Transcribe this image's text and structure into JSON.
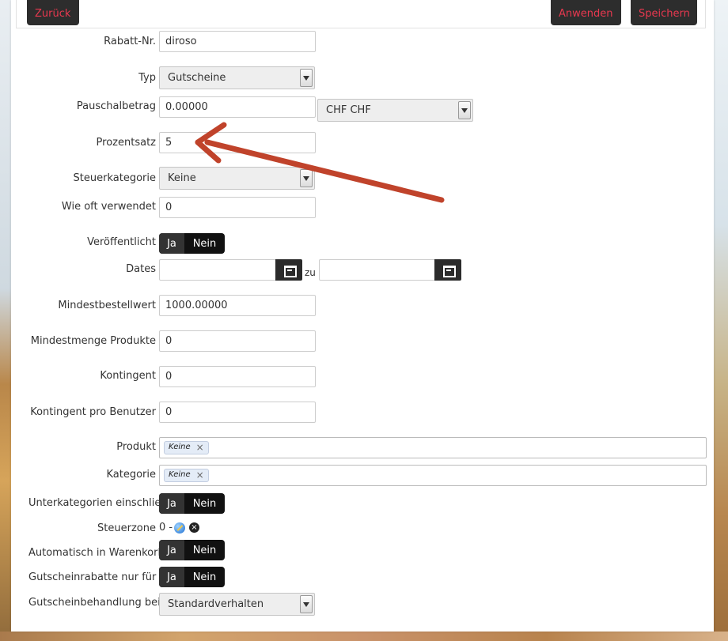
{
  "toolbar": {
    "back_label": "Zurück",
    "apply_label": "Anwenden",
    "save_label": "Speichern"
  },
  "form": {
    "rabatt_nr": {
      "label": "Rabatt-Nr.",
      "value": "diroso"
    },
    "typ": {
      "label": "Typ",
      "value": "Gutscheine"
    },
    "pauschalbetrag": {
      "label": "Pauschalbetrag",
      "value": "0.00000",
      "currency": "CHF CHF"
    },
    "prozentsatz": {
      "label": "Prozentsatz",
      "value": "5"
    },
    "steuerkategorie": {
      "label": "Steuerkategorie",
      "value": "Keine"
    },
    "wie_oft": {
      "label": "Wie oft verwendet",
      "value": "0"
    },
    "veroeffentlicht": {
      "label": "Veröffentlicht",
      "yes": "Ja",
      "no": "Nein",
      "selected": "Ja"
    },
    "dates": {
      "label": "Dates",
      "from": "",
      "to": "",
      "separator": "zu"
    },
    "mindestbestellwert": {
      "label": "Mindestbestellwert",
      "value": "1000.00000"
    },
    "mindestmenge": {
      "label": "Mindestmenge Produkte",
      "value": "0"
    },
    "kontingent": {
      "label": "Kontingent",
      "value": "0"
    },
    "kontingent_user": {
      "label": "Kontingent pro Benutzer",
      "value": "0"
    },
    "produkt": {
      "label": "Produkt",
      "tag": "Keine"
    },
    "kategorie": {
      "label": "Kategorie",
      "tag": "Keine"
    },
    "unterkategorien": {
      "label": "Unterkategorien einschließ",
      "yes": "Ja",
      "no": "Nein"
    },
    "steuerzone": {
      "label": "Steuerzone",
      "value": "0 -"
    },
    "automatisch": {
      "label": "Automatisch in Warenkorb",
      "yes": "Ja",
      "no": "Nein"
    },
    "gutscheinrabatte": {
      "label": "Gutscheinrabatte nur für P",
      "yes": "Ja",
      "no": "Nein"
    },
    "gutscheinbehandlung": {
      "label": "Gutscheinbehandlung bei",
      "value": "Standardverhalten"
    }
  },
  "annotation": {
    "arrow_color": "#c0432b"
  },
  "colors": {
    "toolbar_text": "#e8384f",
    "toggle_bg": "#111111"
  }
}
